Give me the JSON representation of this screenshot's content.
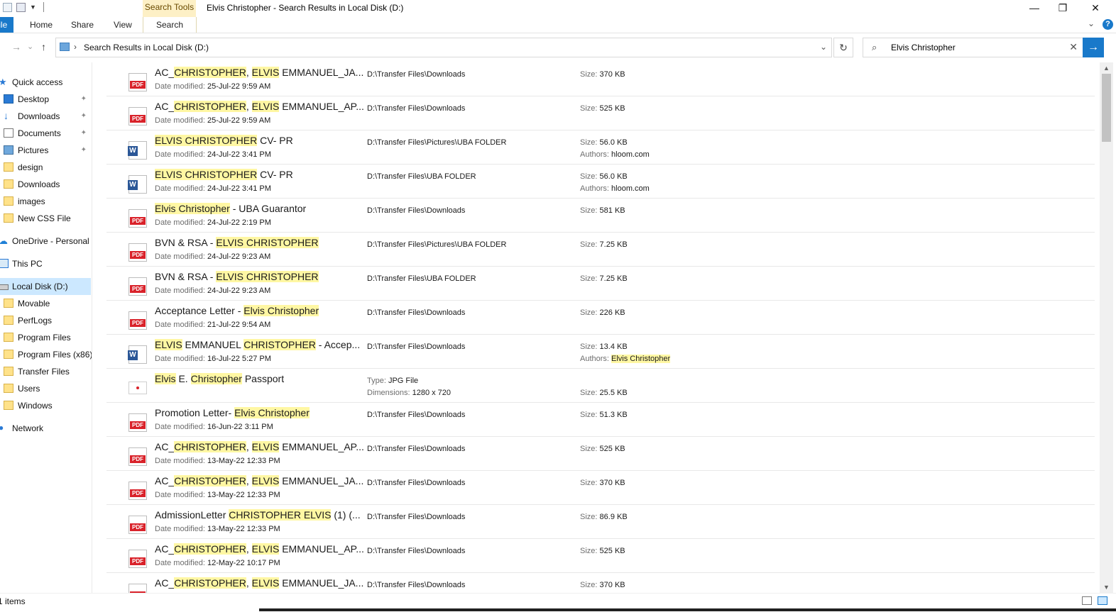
{
  "window": {
    "title": "Elvis Christopher - Search Results in Local Disk (D:)",
    "context_tab_group": "Search Tools",
    "controls": {
      "minimize": "—",
      "restore": "❐",
      "close": "✕"
    }
  },
  "ribbon": {
    "file_tab": "File",
    "tabs": [
      "Home",
      "Share",
      "View",
      "Search"
    ],
    "help": "?"
  },
  "address_bar": {
    "back": "←",
    "forward": "→",
    "recent": "⌄",
    "up": "↑",
    "separator": "›",
    "path": "Search Results in Local Disk (D:)",
    "dropdown": "⌄",
    "refresh": "↻"
  },
  "search": {
    "value": "Elvis Christopher",
    "icon": "search-icon",
    "clear": "✕",
    "go": "→"
  },
  "sidebar": {
    "items": [
      {
        "label": "Quick access",
        "icon": "star-icon",
        "pinned": false
      },
      {
        "label": "Desktop",
        "icon": "desktop-icon",
        "pinned": true
      },
      {
        "label": "Downloads",
        "icon": "download-icon",
        "pinned": true
      },
      {
        "label": "Documents",
        "icon": "documents-icon",
        "pinned": true
      },
      {
        "label": "Pictures",
        "icon": "pictures-icon",
        "pinned": true
      },
      {
        "label": "design",
        "icon": "folder-icon",
        "pinned": false
      },
      {
        "label": "Downloads",
        "icon": "folder-icon",
        "pinned": false
      },
      {
        "label": "images",
        "icon": "folder-icon",
        "pinned": false
      },
      {
        "label": "New CSS File",
        "icon": "folder-icon",
        "pinned": false
      },
      {
        "label": "OneDrive - Personal",
        "icon": "cloud-icon",
        "pinned": false
      },
      {
        "label": "This PC",
        "icon": "pc-icon",
        "pinned": false
      },
      {
        "label": "Local Disk (D:)",
        "icon": "disk-icon",
        "pinned": false,
        "selected": true
      },
      {
        "label": "Movable",
        "icon": "folder-icon",
        "pinned": false
      },
      {
        "label": "PerfLogs",
        "icon": "folder-icon",
        "pinned": false
      },
      {
        "label": "Program Files",
        "icon": "folder-icon",
        "pinned": false
      },
      {
        "label": "Program Files (x86)",
        "icon": "folder-icon",
        "pinned": false
      },
      {
        "label": "Transfer Files",
        "icon": "folder-icon",
        "pinned": false
      },
      {
        "label": "Users",
        "icon": "folder-icon",
        "pinned": false
      },
      {
        "label": "Windows",
        "icon": "folder-icon",
        "pinned": false
      },
      {
        "label": "Network",
        "icon": "network-icon",
        "pinned": false
      }
    ],
    "pin_glyph": "📌"
  },
  "labels": {
    "date_modified": "Date modified:",
    "size": "Size:",
    "authors": "Authors:",
    "type": "Type:",
    "dimensions": "Dimensions:"
  },
  "results": [
    {
      "icon": "pdf",
      "name": [
        [
          "AC_",
          false
        ],
        [
          "CHRISTOPHER",
          true
        ],
        [
          ", ",
          false
        ],
        [
          "ELVIS",
          true
        ],
        [
          " EMMANUEL_JA...",
          false
        ]
      ],
      "date": "25-Jul-22 9:59 AM",
      "path": "D:\\Transfer Files\\Downloads",
      "size": "370 KB"
    },
    {
      "icon": "pdf",
      "name": [
        [
          "AC_",
          false
        ],
        [
          "CHRISTOPHER",
          true
        ],
        [
          ", ",
          false
        ],
        [
          "ELVIS",
          true
        ],
        [
          " EMMANUEL_AP...",
          false
        ]
      ],
      "date": "25-Jul-22 9:59 AM",
      "path": "D:\\Transfer Files\\Downloads",
      "size": "525 KB"
    },
    {
      "icon": "word",
      "name": [
        [
          "ELVIS CHRISTOPHER",
          true
        ],
        [
          " CV- PR",
          false
        ]
      ],
      "date": "24-Jul-22 3:41 PM",
      "path": "D:\\Transfer Files\\Pictures\\UBA FOLDER",
      "size": "56.0 KB",
      "authors": [
        [
          "hloom.com",
          false
        ]
      ]
    },
    {
      "icon": "word",
      "name": [
        [
          "ELVIS CHRISTOPHER",
          true
        ],
        [
          " CV- PR",
          false
        ]
      ],
      "date": "24-Jul-22 3:41 PM",
      "path": "D:\\Transfer Files\\UBA FOLDER",
      "size": "56.0 KB",
      "authors": [
        [
          "hloom.com",
          false
        ]
      ]
    },
    {
      "icon": "pdf",
      "name": [
        [
          "Elvis Christopher",
          true
        ],
        [
          " - UBA Guarantor",
          false
        ]
      ],
      "date": "24-Jul-22 2:19 PM",
      "path": "D:\\Transfer Files\\Downloads",
      "size": "581 KB"
    },
    {
      "icon": "pdf",
      "name": [
        [
          "BVN & RSA - ",
          false
        ],
        [
          "ELVIS CHRISTOPHER",
          true
        ]
      ],
      "date": "24-Jul-22 9:23 AM",
      "path": "D:\\Transfer Files\\Pictures\\UBA FOLDER",
      "size": "7.25 KB"
    },
    {
      "icon": "pdf",
      "name": [
        [
          "BVN & RSA - ",
          false
        ],
        [
          "ELVIS CHRISTOPHER",
          true
        ]
      ],
      "date": "24-Jul-22 9:23 AM",
      "path": "D:\\Transfer Files\\UBA FOLDER",
      "size": "7.25 KB"
    },
    {
      "icon": "pdf",
      "name": [
        [
          "Acceptance Letter - ",
          false
        ],
        [
          "Elvis Christopher",
          true
        ]
      ],
      "date": "21-Jul-22 9:54 AM",
      "path": "D:\\Transfer Files\\Downloads",
      "size": "226 KB"
    },
    {
      "icon": "word",
      "name": [
        [
          "ELVIS",
          true
        ],
        [
          " EMMANUEL ",
          false
        ],
        [
          "CHRISTOPHER",
          true
        ],
        [
          " - Accep...",
          false
        ]
      ],
      "date": "16-Jul-22 5:27 PM",
      "path": "D:\\Transfer Files\\Downloads",
      "size": "13.4 KB",
      "authors": [
        [
          "Elvis Christopher",
          true
        ]
      ]
    },
    {
      "icon": "jpg",
      "name": [
        [
          "Elvis",
          true
        ],
        [
          " E. ",
          false
        ],
        [
          "Christopher",
          true
        ],
        [
          " Passport",
          false
        ]
      ],
      "type": "JPG File",
      "dimensions": "1280 x 720",
      "size": "25.5 KB"
    },
    {
      "icon": "pdf",
      "name": [
        [
          "Promotion Letter- ",
          false
        ],
        [
          "Elvis Christopher",
          true
        ]
      ],
      "date": "16-Jun-22 3:11 PM",
      "path": "D:\\Transfer Files\\Downloads",
      "size": "51.3 KB"
    },
    {
      "icon": "pdf",
      "name": [
        [
          "AC_",
          false
        ],
        [
          "CHRISTOPHER",
          true
        ],
        [
          ", ",
          false
        ],
        [
          "ELVIS",
          true
        ],
        [
          " EMMANUEL_AP...",
          false
        ]
      ],
      "date": "13-May-22 12:33 PM",
      "path": "D:\\Transfer Files\\Downloads",
      "size": "525 KB"
    },
    {
      "icon": "pdf",
      "name": [
        [
          "AC_",
          false
        ],
        [
          "CHRISTOPHER",
          true
        ],
        [
          ", ",
          false
        ],
        [
          "ELVIS",
          true
        ],
        [
          " EMMANUEL_JA...",
          false
        ]
      ],
      "date": "13-May-22 12:33 PM",
      "path": "D:\\Transfer Files\\Downloads",
      "size": "370 KB"
    },
    {
      "icon": "pdf",
      "name": [
        [
          "AdmissionLetter ",
          false
        ],
        [
          "CHRISTOPHER ELVIS",
          true
        ],
        [
          " (1) (...",
          false
        ]
      ],
      "date": "13-May-22 12:33 PM",
      "path": "D:\\Transfer Files\\Downloads",
      "size": "86.9 KB"
    },
    {
      "icon": "pdf",
      "name": [
        [
          "AC_",
          false
        ],
        [
          "CHRISTOPHER",
          true
        ],
        [
          ", ",
          false
        ],
        [
          "ELVIS",
          true
        ],
        [
          " EMMANUEL_AP...",
          false
        ]
      ],
      "date": "12-May-22 10:17 PM",
      "path": "D:\\Transfer Files\\Downloads",
      "size": "525 KB"
    },
    {
      "icon": "pdf",
      "name": [
        [
          "AC_",
          false
        ],
        [
          "CHRISTOPHER",
          true
        ],
        [
          ", ",
          false
        ],
        [
          "ELVIS",
          true
        ],
        [
          " EMMANUEL_JA...",
          false
        ]
      ],
      "date": "",
      "path": "D:\\Transfer Files\\Downloads",
      "size": "370 KB"
    }
  ],
  "scrollbar": {
    "up": "▲",
    "down": "▼"
  },
  "status": {
    "count": "1 items"
  },
  "colors": {
    "accent": "#1979ca",
    "highlight": "#fff7a3",
    "selected": "#cce8ff",
    "context_tab": "#fdf0c6"
  }
}
